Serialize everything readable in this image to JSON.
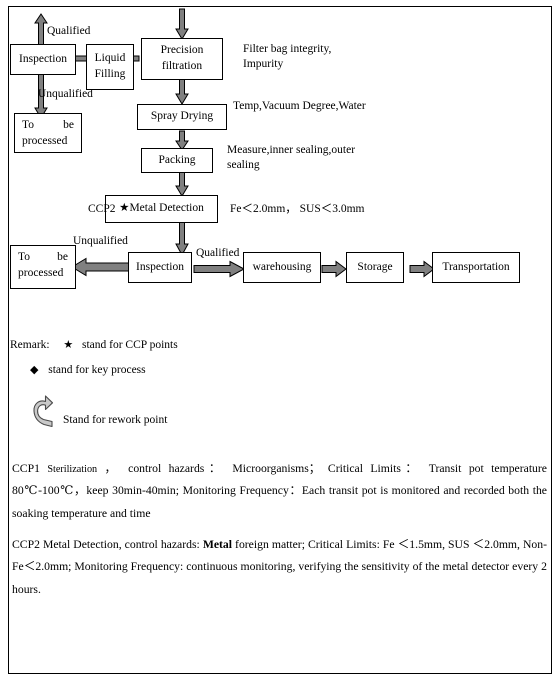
{
  "document": {
    "type": "HACCP process flow chart"
  },
  "flowchart": {
    "boxes": [
      {
        "id": "inspection_top",
        "label": "Inspection"
      },
      {
        "id": "liquid_filling",
        "label_line1": "Liquid",
        "label_line2": "Filling"
      },
      {
        "id": "precision_filtration",
        "label_line1": "Precision",
        "label_line2": "filtration"
      },
      {
        "id": "to_be_processed_top",
        "label_line1": "To          be",
        "label_line2": "processed"
      },
      {
        "id": "spray_drying",
        "label": "Spray Drying"
      },
      {
        "id": "packing",
        "label": "Packing"
      },
      {
        "id": "metal_detection",
        "label": "★Metal Detection"
      },
      {
        "id": "to_be_processed_bottom",
        "label_line1": "To          be",
        "label_line2": "processed"
      },
      {
        "id": "inspection_bottom",
        "label": "Inspection"
      },
      {
        "id": "warehousing",
        "label": "warehousing"
      },
      {
        "id": "storage",
        "label": "Storage"
      },
      {
        "id": "transportation",
        "label": "Transportation"
      }
    ],
    "edge_labels": {
      "qualified_top": "Qualified",
      "unqualified_top": "Unqualified",
      "unqualified_bottom": "Unqualified",
      "qualified_bottom": "Qualified"
    },
    "ccp_labels": {
      "ccp2": "CCP2"
    },
    "annotations": {
      "filter_bag_line1": "Filter bag integrity,",
      "filter_bag_line2": "Impurity",
      "spray_drying_note": "Temp,Vacuum Degree,Water",
      "packing_note_line1": "Measure,inner    sealing,outer",
      "packing_note_line2": "sealing",
      "metal_detection_note": "Fe＜2.0mm， SUS＜3.0mm"
    }
  },
  "legend": {
    "remark_prefix": "Remark:",
    "star_symbol": "★",
    "star_text": "stand for CCP points",
    "diamond_symbol": "◆",
    "diamond_text": "stand for    key process",
    "rework_icon": "rework-curved-arrow",
    "rework_text": "Stand for rework point"
  },
  "ccp_details": {
    "ccp1": {
      "prefix": "CCP1 ",
      "small": "Sterilization",
      "body": " ， control hazards： Microorganisms； Critical Limits： Transit pot temperature 80℃-100℃，keep 30min-40min; Monitoring Frequency：Each transit pot is monitored and recorded both the soaking temperature and time"
    },
    "ccp2": {
      "before_bold": "CCP2 Metal Detection, control hazards: ",
      "bold": "Metal",
      "after_bold": " foreign matter; Critical Limits: Fe ＜1.5mm, SUS ＜2.0mm, Non-Fe＜2.0mm; Monitoring Frequency: continuous monitoring, verifying the sensitivity of the metal detector every 2 hours."
    }
  },
  "colors": {
    "arrow_fill": "#808080",
    "arrow_stroke": "#000000",
    "border": "#000000",
    "background": "#ffffff"
  }
}
